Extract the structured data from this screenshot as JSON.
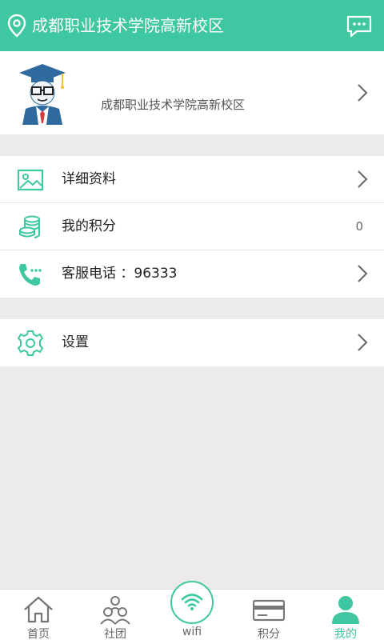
{
  "header": {
    "title": "成都职业技术学院高新校区",
    "location_icon": "location-pin-icon",
    "message_icon": "message-icon"
  },
  "profile": {
    "school": "成都职业技术学院高新校区"
  },
  "menu": {
    "details": "详细资料",
    "points": "我的积分",
    "points_value": "0",
    "service": "客服电话 ：96333",
    "settings": "设置"
  },
  "tabbar": {
    "home": "首页",
    "community": "社团",
    "wifi": "wifi",
    "points": "积分",
    "mine": "我的"
  },
  "colors": {
    "accent": "#3ec7a0",
    "background": "#ebebeb"
  }
}
